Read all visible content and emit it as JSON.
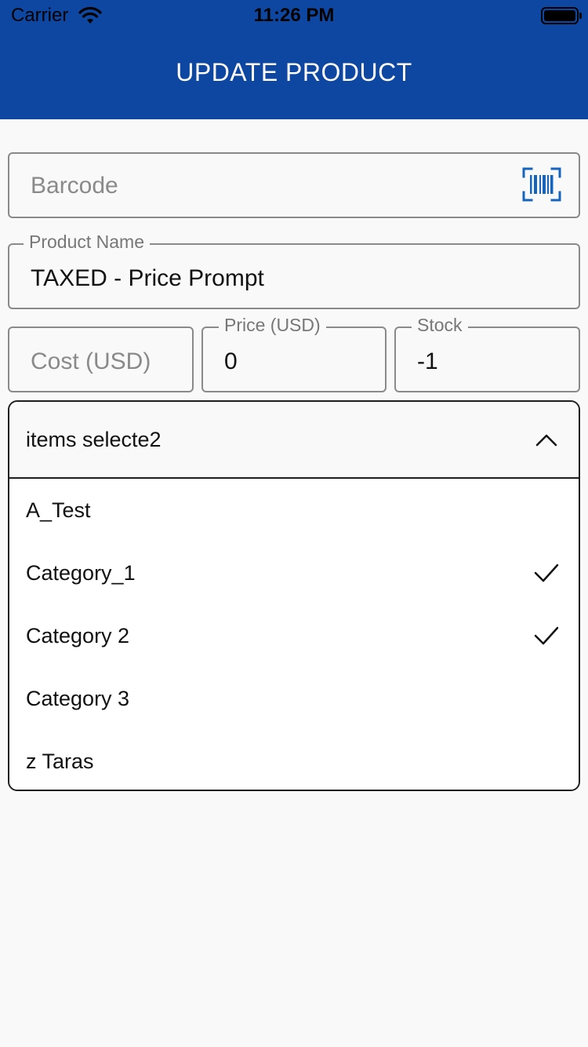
{
  "status_bar": {
    "carrier": "Carrier",
    "time": "11:26 PM"
  },
  "header": {
    "title": "UPDATE PRODUCT"
  },
  "colors": {
    "header_bg": "#0d47a1",
    "barcode_icon": "#1565c0"
  },
  "form": {
    "barcode": {
      "placeholder": "Barcode",
      "icon": "barcode-scan-icon"
    },
    "product_name": {
      "label": "Product Name",
      "value": "TAXED - Price Prompt"
    },
    "cost": {
      "placeholder": "Cost (USD)"
    },
    "price": {
      "label": "Price (USD)",
      "value": "0"
    },
    "stock": {
      "label": "Stock",
      "value": "-1"
    }
  },
  "category_dropdown": {
    "summary": "items selecte2",
    "expanded": true,
    "options": [
      {
        "label": "A_Test",
        "selected": false
      },
      {
        "label": "Category_1",
        "selected": true
      },
      {
        "label": "Category 2",
        "selected": true
      },
      {
        "label": "Category 3",
        "selected": false
      },
      {
        "label": "z Taras",
        "selected": false
      }
    ]
  }
}
